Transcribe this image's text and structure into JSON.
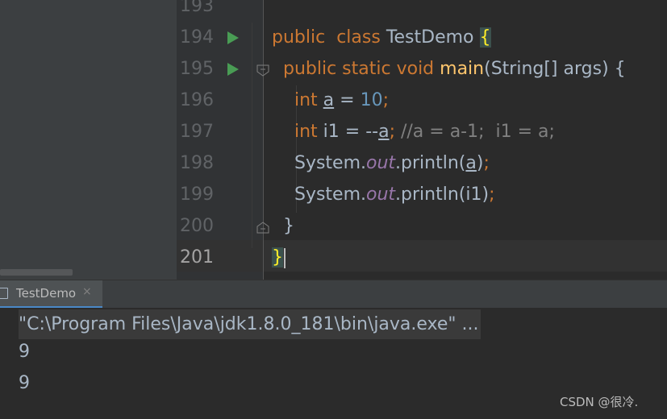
{
  "editor": {
    "lines": [
      {
        "number": "193"
      },
      {
        "number": "194",
        "run": true,
        "tokens": [
          {
            "t": "public",
            "c": "kw"
          },
          {
            "t": "  "
          },
          {
            "t": "class",
            "c": "kw"
          },
          {
            "t": " TestDemo "
          },
          {
            "t": "{",
            "c": "brace"
          }
        ]
      },
      {
        "number": "195",
        "run": true,
        "fold": "open",
        "tokens": [
          {
            "t": "  "
          },
          {
            "t": "public static void",
            "c": "kw"
          },
          {
            "t": " "
          },
          {
            "t": "main",
            "c": "fn"
          },
          {
            "t": "(String[] args) {"
          }
        ]
      },
      {
        "number": "196",
        "tokens": [
          {
            "t": "    "
          },
          {
            "t": "int",
            "c": "kw"
          },
          {
            "t": " "
          },
          {
            "t": "a",
            "c": "ul"
          },
          {
            "t": " = "
          },
          {
            "t": "10",
            "c": "num"
          },
          {
            "t": ";",
            "c": "kw"
          }
        ]
      },
      {
        "number": "197",
        "tokens": [
          {
            "t": "    "
          },
          {
            "t": "int",
            "c": "kw"
          },
          {
            "t": " i1 = --"
          },
          {
            "t": "a",
            "c": "ul"
          },
          {
            "t": ";",
            "c": "kw"
          },
          {
            "t": " //a = a-1;  i1 = a;",
            "c": "cmt"
          }
        ]
      },
      {
        "number": "198",
        "tokens": [
          {
            "t": "    System."
          },
          {
            "t": "out",
            "c": "fld"
          },
          {
            "t": ".println("
          },
          {
            "t": "a",
            "c": "ul"
          },
          {
            "t": ")"
          },
          {
            "t": ";",
            "c": "kw"
          }
        ]
      },
      {
        "number": "199",
        "tokens": [
          {
            "t": "    System."
          },
          {
            "t": "out",
            "c": "fld"
          },
          {
            "t": ".println(i1)"
          },
          {
            "t": ";",
            "c": "kw"
          }
        ]
      },
      {
        "number": "200",
        "fold": "close",
        "tokens": [
          {
            "t": "  }"
          }
        ]
      },
      {
        "number": "201",
        "current": true,
        "tokens": [
          {
            "t": "}",
            "c": "brace"
          },
          {
            "t": "",
            "c": "caret"
          }
        ]
      }
    ]
  },
  "run_panel": {
    "tab_label": "TestDemo",
    "tab_close": "×",
    "command": "\"C:\\Program Files\\Java\\jdk1.8.0_181\\bin\\java.exe\" ...",
    "output": [
      "9",
      "9"
    ]
  },
  "watermark": "CSDN @很冷."
}
